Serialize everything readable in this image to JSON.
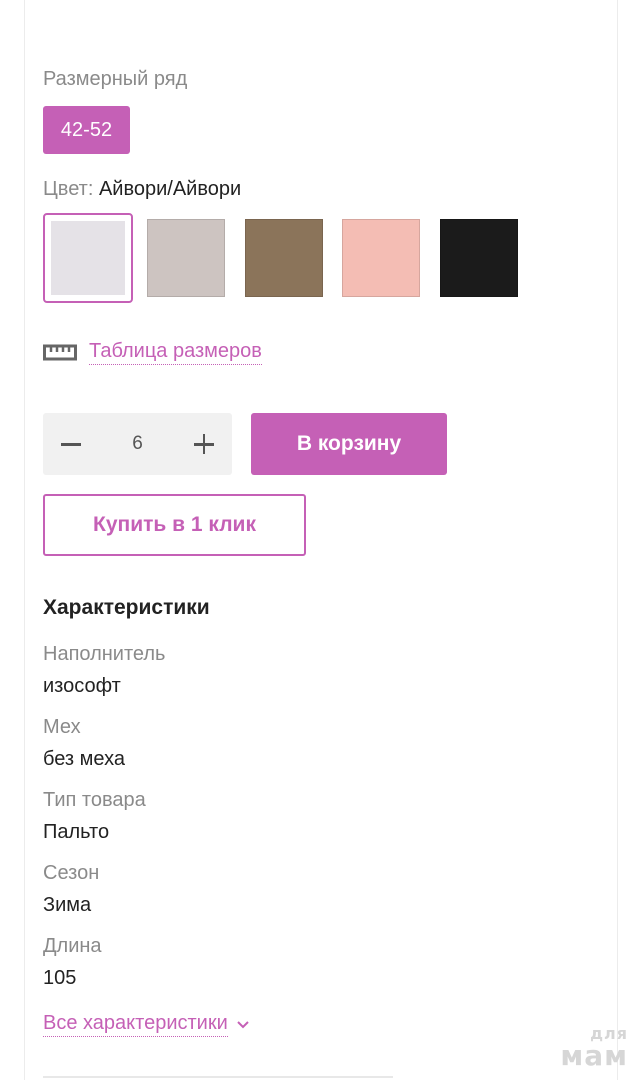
{
  "size_range": {
    "label": "Размерный ряд",
    "selected": "42-52"
  },
  "color": {
    "label": "Цвет:",
    "selected_name": "Айвори/Айвори",
    "swatches": [
      {
        "name": "swatch-ivory",
        "color": "#e5e2e7",
        "selected": true
      },
      {
        "name": "swatch-beige-gray",
        "color": "#cdc4c1",
        "selected": false
      },
      {
        "name": "swatch-brown",
        "color": "#8b745a",
        "selected": false
      },
      {
        "name": "swatch-pink",
        "color": "#f4bdb4",
        "selected": false
      },
      {
        "name": "swatch-black",
        "color": "#1b1b1b",
        "selected": false
      }
    ]
  },
  "size_table": {
    "label": "Таблица размеров",
    "icon": "ruler-icon"
  },
  "quantity": {
    "value": "6",
    "minus_icon": "minus-icon",
    "plus_icon": "plus-icon"
  },
  "buttons": {
    "add_to_cart": "В корзину",
    "one_click": "Купить в 1 клик"
  },
  "characteristics": {
    "title": "Характеристики",
    "items": [
      {
        "key": "Наполнитель",
        "value": "изософт"
      },
      {
        "key": "Мех",
        "value": "без меха"
      },
      {
        "key": "Тип товара",
        "value": "Пальто"
      },
      {
        "key": "Сезон",
        "value": "Зима"
      },
      {
        "key": "Длина",
        "value": "105"
      }
    ],
    "all_link": "Все характеристики"
  },
  "watermark": {
    "line1": "для",
    "line2": "мам"
  },
  "colors": {
    "accent": "#c560b6",
    "muted": "#8a8a8a",
    "qty_bg": "#f1f1f1"
  }
}
